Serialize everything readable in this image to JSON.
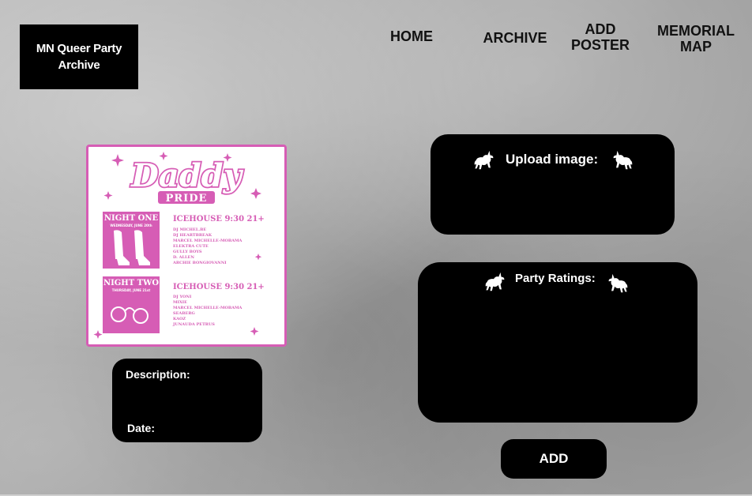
{
  "logo": {
    "line1": "MN Queer Party",
    "line2": "Archive"
  },
  "nav": {
    "home": "HOME",
    "archive": "ARCHIVE",
    "add_poster": {
      "line1": "ADD",
      "line2": "POSTER"
    },
    "memorial_map": {
      "line1": "MEMORIAL",
      "line2": "MAP"
    }
  },
  "poster": {
    "title": "Daddy",
    "subtitle": "PRIDE",
    "nights": [
      {
        "badge_title": "NIGHT ONE",
        "badge_date": "WEDNESDAY, JUNE 20th",
        "venue": "ICEHOUSE  9:30  21+",
        "lineup": [
          "DJ MICHEL.BE",
          "DJ HEARTBREAK",
          "MARCEL MICHELLE-MOBAMA",
          "ELEKTRA CUTE",
          "GULLY BOYS",
          "D. ALLEN",
          "ARCHIE BONGIOVANNI"
        ]
      },
      {
        "badge_title": "NIGHT TWO",
        "badge_date": "THURSDAY, JUNE 21st",
        "venue": "ICEHOUSE  9:30  21+",
        "lineup": [
          "DJ YONI",
          "MIXIE",
          "MARCEL MICHELLE-MOBAMA",
          "SEABERG",
          "KAOZ",
          "JUNAUDA PETRUS"
        ]
      }
    ]
  },
  "description_box": {
    "description_label": "Description:",
    "date_label": "Date:"
  },
  "upload": {
    "label": "Upload image:"
  },
  "ratings": {
    "label": "Party Ratings:"
  },
  "add_button": {
    "label": "ADD"
  },
  "colors": {
    "panel": "#000000",
    "poster_pink": "#d65db5",
    "nav_text": "#111111"
  },
  "icons": {
    "decoration": "unicorn-icon"
  }
}
